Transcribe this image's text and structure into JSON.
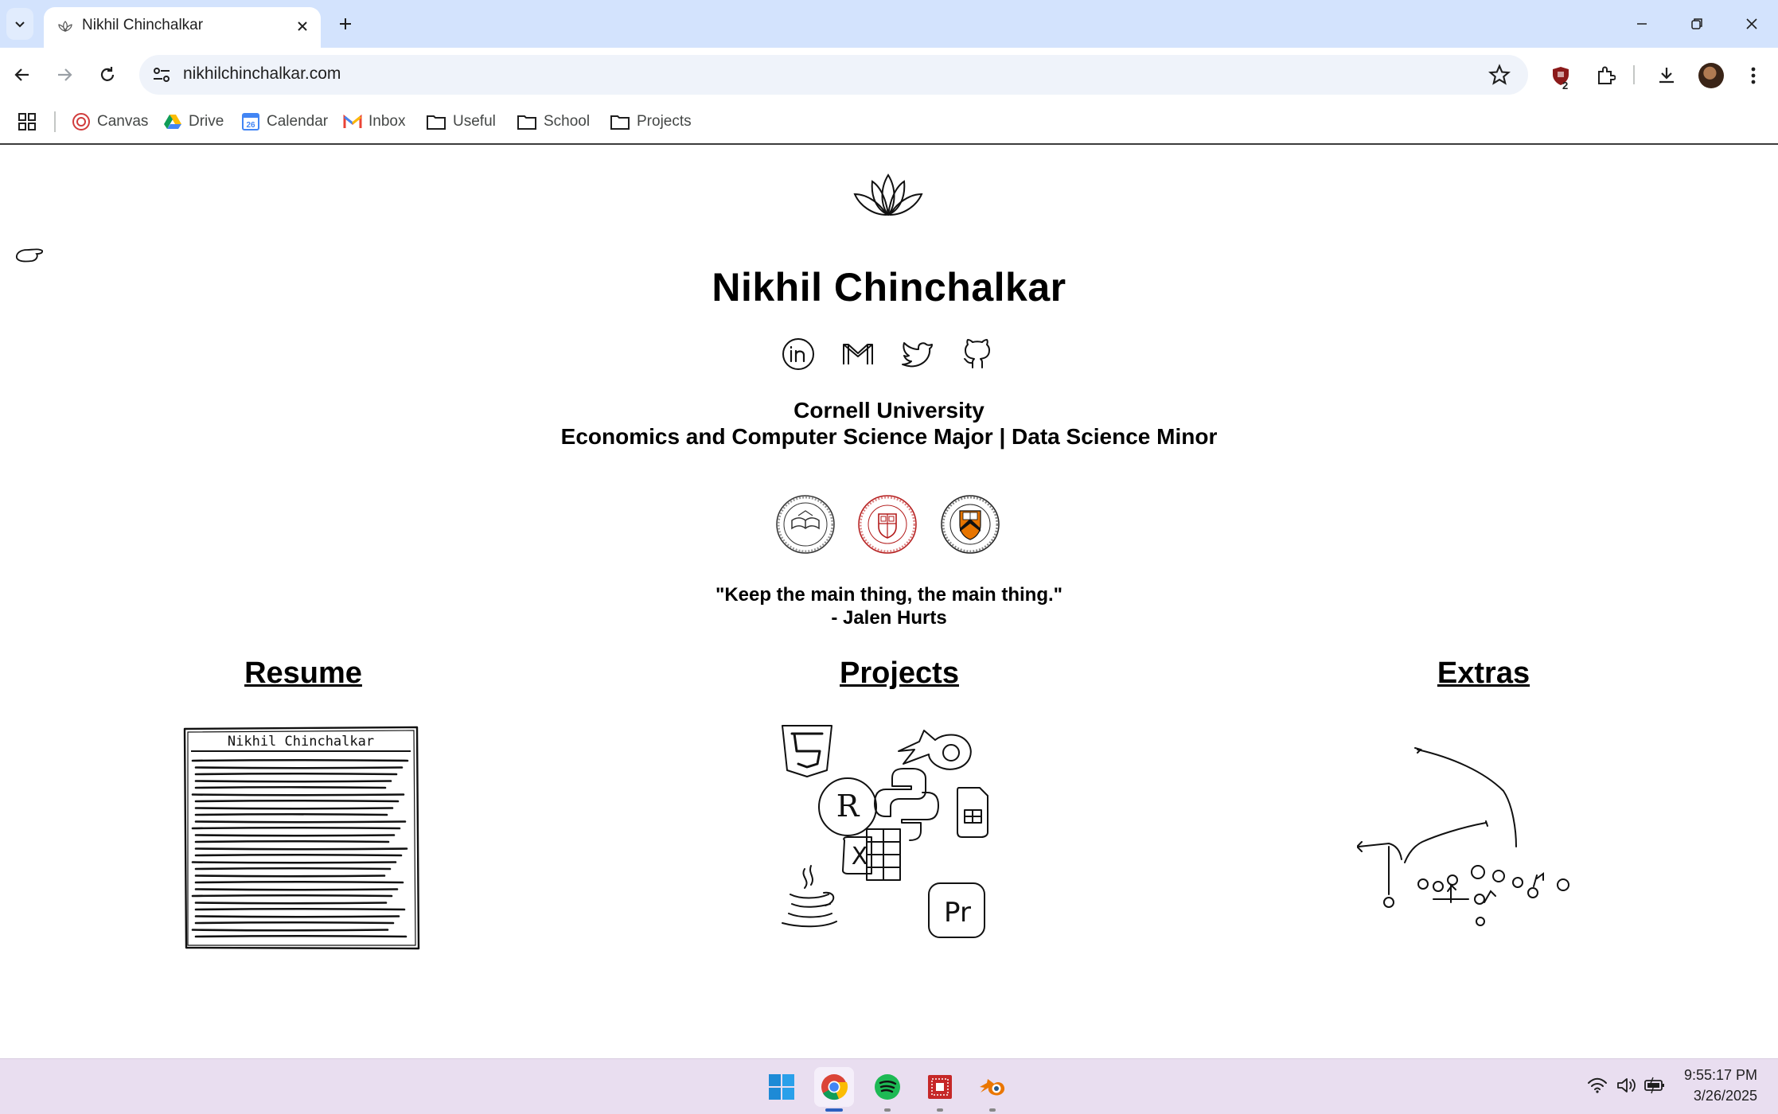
{
  "browser": {
    "tab": {
      "title": "Nikhil Chinchalkar"
    },
    "url": "nikhilchinchalkar.com",
    "extension_badge": "2",
    "bookmarks": [
      {
        "label": "Canvas",
        "icon": "canvas-icon"
      },
      {
        "label": "Drive",
        "icon": "drive-icon"
      },
      {
        "label": "Calendar",
        "icon": "calendar-icon"
      },
      {
        "label": "Inbox",
        "icon": "gmail-icon"
      },
      {
        "label": "Useful",
        "icon": "folder-icon"
      },
      {
        "label": "School",
        "icon": "folder-icon"
      },
      {
        "label": "Projects",
        "icon": "folder-icon"
      }
    ],
    "calendar_day": "26"
  },
  "page": {
    "name": "Nikhil Chinchalkar",
    "socials": [
      "linkedin-icon",
      "gmail-icon",
      "twitter-icon",
      "github-icon"
    ],
    "school": "Cornell University",
    "major": "Economics and Computer Science Major | Data Science Minor",
    "quote": "\"Keep the main thing, the main thing.\"",
    "quote_author": "- Jalen Hurts",
    "sections": {
      "resume": "Resume",
      "projects": "Projects",
      "extras": "Extras"
    },
    "resume_sketch_header": "Nikhil Chinchalkar"
  },
  "taskbar": {
    "time": "9:55:17 PM",
    "date": "3/26/2025",
    "apps": [
      "windows-start-icon",
      "chrome-icon",
      "spotify-icon",
      "app-icon",
      "blender-icon"
    ]
  },
  "colors": {
    "titlebar": "#d3e3fd",
    "taskbar": "#e9def0",
    "cornell_red": "#b31b1b",
    "princeton_orange": "#e77500"
  }
}
